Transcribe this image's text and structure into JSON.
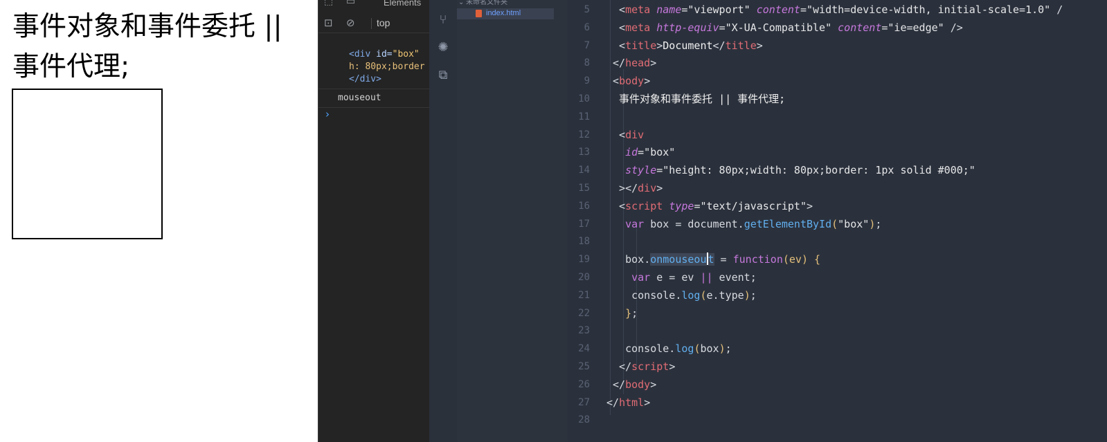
{
  "preview": {
    "heading": "事件对象和事件委托 || 事件代理;"
  },
  "devtools": {
    "tab_label": "Elements",
    "context": "top",
    "log_lines": [
      {
        "tag_open": "<div ",
        "attr_name": "id=",
        "attr_val": "\"box\" ",
        "rest": ""
      },
      {
        "tag_open": "",
        "attr_name": "",
        "attr_val": "",
        "rest": "h: 80px;border"
      },
      {
        "tag_open": "</div>",
        "attr_name": "",
        "attr_val": "",
        "rest": ""
      }
    ],
    "log_message": "mouseout",
    "prompt": "›"
  },
  "explorer": {
    "folder": "未命名文件夹",
    "file": "index.html"
  },
  "editor": {
    "lines": [
      {
        "n": "5"
      },
      {
        "n": "6"
      },
      {
        "n": "7"
      },
      {
        "n": "8"
      },
      {
        "n": "9"
      },
      {
        "n": "10"
      },
      {
        "n": "11"
      },
      {
        "n": "12"
      },
      {
        "n": "13"
      },
      {
        "n": "14"
      },
      {
        "n": "15"
      },
      {
        "n": "16"
      },
      {
        "n": "17"
      },
      {
        "n": "18"
      },
      {
        "n": "19"
      },
      {
        "n": "20"
      },
      {
        "n": "21"
      },
      {
        "n": "22"
      },
      {
        "n": "23"
      },
      {
        "n": "24"
      },
      {
        "n": "25"
      },
      {
        "n": "26"
      },
      {
        "n": "27"
      },
      {
        "n": "28"
      }
    ],
    "code": {
      "l5": [
        "<",
        "meta",
        "name",
        "=\"viewport\"",
        "content",
        "=\"width=device-width, initial-scale=1.0\"",
        " /"
      ],
      "l6": [
        "<",
        "meta",
        "http-equiv",
        "=\"X-UA-Compatible\"",
        "content",
        "=\"ie=edge\"",
        " />"
      ],
      "l7": [
        "<",
        "title",
        ">",
        "Document",
        "</",
        "title",
        ">"
      ],
      "l8": [
        "</",
        "head",
        ">"
      ],
      "l9": [
        "<",
        "body",
        ">"
      ],
      "l10": "事件对象和事件委托 || 事件代理;",
      "l12": [
        "<",
        "div"
      ],
      "l13": [
        "id",
        "=\"box\""
      ],
      "l14": [
        "style",
        "=\"height: 80px;width: 80px;border: 1px solid #000;\""
      ],
      "l15": [
        "></",
        "div",
        ">"
      ],
      "l16": [
        "<",
        "script",
        "type",
        "=\"text/javascript\"",
        ">"
      ],
      "l17": [
        "var",
        "box",
        "=",
        "document",
        ".",
        "getElementById",
        "(",
        "\"box\"",
        ")",
        ";"
      ],
      "l19": [
        "box",
        ".",
        "onmouseou",
        "t",
        "=",
        "function",
        "(",
        "ev",
        ")",
        "{"
      ],
      "l20": [
        "var",
        "e",
        "=",
        "ev",
        "||",
        "event",
        ";"
      ],
      "l21": [
        "console",
        ".",
        "log",
        "(",
        "e",
        ".",
        "type",
        ")",
        ";"
      ],
      "l22": [
        "}",
        ";"
      ],
      "l24": [
        "console",
        ".",
        "log",
        "(",
        "box",
        ")",
        ";"
      ],
      "l25": [
        "</",
        "script",
        ">"
      ],
      "l26": [
        "</",
        "body",
        ">"
      ],
      "l27": [
        "</",
        "html",
        ">"
      ]
    }
  }
}
